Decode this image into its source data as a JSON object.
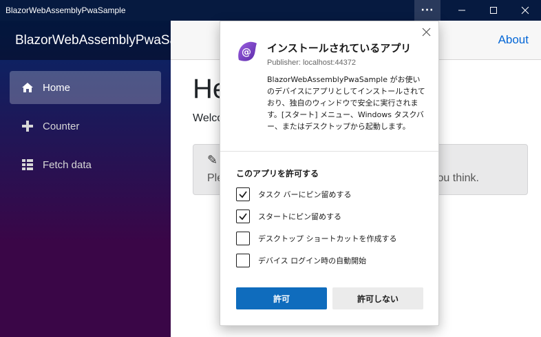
{
  "window": {
    "title": "BlazorWebAssemblyPwaSample"
  },
  "sidebar": {
    "brand": "BlazorWebAssemblyPwaSample",
    "items": [
      {
        "label": "Home",
        "icon": "home-icon"
      },
      {
        "label": "Counter",
        "icon": "plus-icon"
      },
      {
        "label": "Fetch data",
        "icon": "list-icon"
      }
    ]
  },
  "topbar": {
    "about": "About"
  },
  "main": {
    "heading": "He",
    "welcome": "Welco",
    "survey_text_left": "Ple",
    "survey_text_right": "ou think."
  },
  "dialog": {
    "title": "インストールされているアプリ",
    "publisher": "Publisher: localhost:44372",
    "description": "BlazorWebAssemblyPwaSample がお使いのデバイスにアプリとしてインストールされており、独自のウィンドウで安全に実行されます。[スタート] メニュー、Windows タスクバー、またはデスクトップから起動します。",
    "section_title": "このアプリを許可する",
    "options": [
      {
        "label": "タスク バーにピン留めする",
        "checked": true
      },
      {
        "label": "スタートにピン留めする",
        "checked": true
      },
      {
        "label": "デスクトップ ショートカットを作成する",
        "checked": false
      },
      {
        "label": "デバイス ログイン時の自動開始",
        "checked": false
      }
    ],
    "allow_label": "許可",
    "deny_label": "許可しない"
  },
  "colors": {
    "titlebar": "#061a40",
    "accent": "#0f6cbd",
    "link": "#0366d6"
  }
}
